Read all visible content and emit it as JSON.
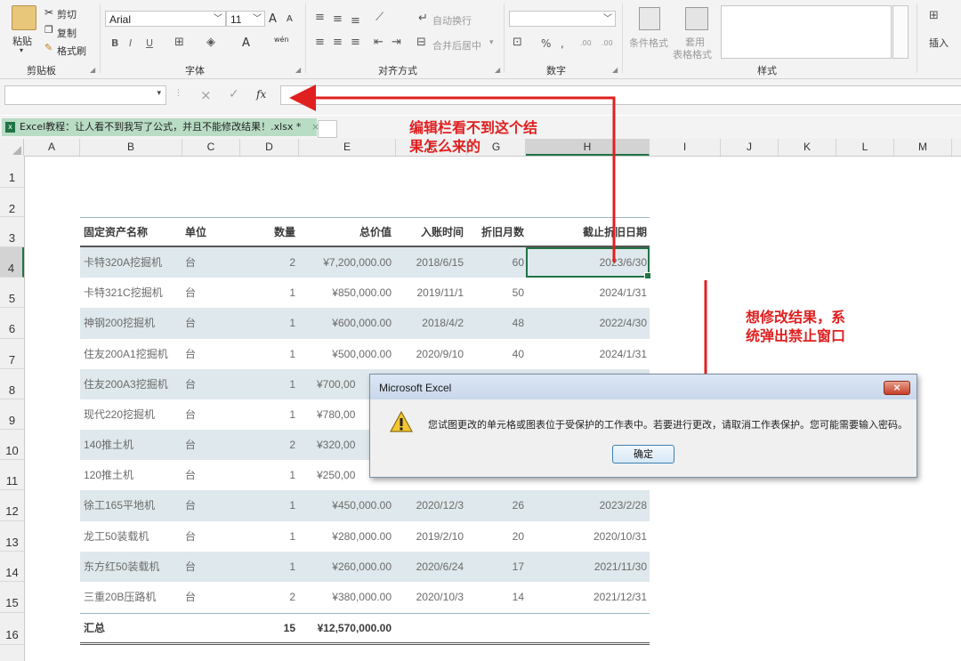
{
  "ribbon": {
    "clipboard": {
      "paste": "粘贴",
      "cut": "剪切",
      "copy": "复制",
      "format_painter": "格式刷",
      "group": "剪贴板"
    },
    "font": {
      "name": "Arial",
      "size": "11",
      "bold": "B",
      "italic": "I",
      "underline": "U",
      "grow": "A",
      "shrink": "A",
      "color_a": "A",
      "phonetic": "wén",
      "group": "字体"
    },
    "alignment": {
      "wrap": "自动换行",
      "merge": "合并后居中",
      "group": "对齐方式"
    },
    "number": {
      "percent": "%",
      "comma": ",",
      "inc_decimal": ".00",
      "dec_decimal": ".00",
      "group": "数字"
    },
    "styles": {
      "conditional": "条件格式",
      "table_format_1": "套用",
      "table_format_2": "表格格式",
      "group": "样式"
    },
    "cells": {
      "insert": "插入"
    }
  },
  "formula_bar": {
    "fx": "fx",
    "cancel": "×",
    "confirm": "✓",
    "value": ""
  },
  "tab": {
    "title": "Excel教程：让人看不到我写了公式，并且不能修改结果！.xlsx *",
    "close": "×"
  },
  "columns": [
    "A",
    "B",
    "C",
    "D",
    "E",
    "F",
    "G",
    "H",
    "I",
    "J",
    "K",
    "L",
    "M"
  ],
  "rows": [
    "1",
    "2",
    "3",
    "4",
    "5",
    "6",
    "7",
    "8",
    "9",
    "10",
    "11",
    "12",
    "13",
    "14",
    "15",
    "16"
  ],
  "table": {
    "headers": [
      "固定资产名称",
      "单位",
      "数量",
      "总价值",
      "入账时间",
      "折旧月数",
      "截止折旧日期"
    ],
    "rows": [
      [
        "卡特320A挖掘机",
        "台",
        "2",
        "¥7,200,000.00",
        "2018/6/15",
        "60",
        "2023/6/30"
      ],
      [
        "卡特321C挖掘机",
        "台",
        "1",
        "¥850,000.00",
        "2019/11/1",
        "50",
        "2024/1/31"
      ],
      [
        "神钢200挖掘机",
        "台",
        "1",
        "¥600,000.00",
        "2018/4/2",
        "48",
        "2022/4/30"
      ],
      [
        "住友200A1挖掘机",
        "台",
        "1",
        "¥500,000.00",
        "2020/9/10",
        "40",
        "2024/1/31"
      ],
      [
        "住友200A3挖掘机",
        "台",
        "1",
        "¥700,00",
        "",
        "",
        ""
      ],
      [
        "现代220挖掘机",
        "台",
        "1",
        "¥780,00",
        "",
        "",
        ""
      ],
      [
        "140推土机",
        "台",
        "2",
        "¥320,00",
        "",
        "",
        ""
      ],
      [
        "120推土机",
        "台",
        "1",
        "¥250,00",
        "",
        "",
        ""
      ],
      [
        "徐工165平地机",
        "台",
        "1",
        "¥450,000.00",
        "2020/12/3",
        "26",
        "2023/2/28"
      ],
      [
        "龙工50装载机",
        "台",
        "1",
        "¥280,000.00",
        "2019/2/10",
        "20",
        "2020/10/31"
      ],
      [
        "东方红50装载机",
        "台",
        "1",
        "¥260,000.00",
        "2020/6/24",
        "17",
        "2021/11/30"
      ],
      [
        "三重20B压路机",
        "台",
        "2",
        "¥380,000.00",
        "2020/10/3",
        "14",
        "2021/12/31"
      ]
    ],
    "total": {
      "label": "汇总",
      "qty": "15",
      "value": "¥12,570,000.00"
    }
  },
  "annotations": {
    "formula_note": [
      "编辑栏看不到这个结",
      "果怎么来的"
    ],
    "dialog_note": [
      "想修改结果，系",
      "统弹出禁止窗口"
    ]
  },
  "dialog": {
    "title": "Microsoft Excel",
    "message": "您试图更改的单元格或图表位于受保护的工作表中。若要进行更改，请取消工作表保护。您可能需要输入密码。",
    "ok": "确定",
    "close": "×"
  },
  "colors": {
    "annotation": "#e02020",
    "band": "#dfe8ec",
    "selection": "#217346",
    "tab": "#b9dcc5"
  }
}
